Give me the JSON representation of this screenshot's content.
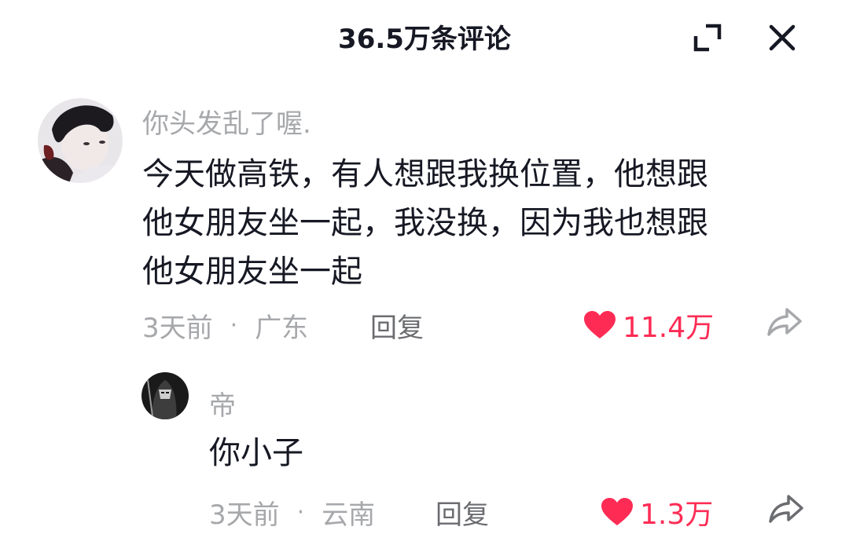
{
  "header": {
    "title": "36.5万条评论",
    "expand_icon": "expand-icon",
    "close_icon": "close-icon"
  },
  "comments": [
    {
      "username": "你头发乱了喔.",
      "text_lines": [
        "今天做高铁，有人想跟我换位置，他想跟",
        "他女朋友坐一起，我没换，因为我也想跟",
        "他女朋友坐一起"
      ],
      "time": "3天前",
      "separator": "·",
      "location": "广东",
      "reply_label": "回复",
      "likes": "11.4万",
      "liked": true
    }
  ],
  "reply": {
    "username": "帝",
    "text": "你小子",
    "time": "3天前",
    "separator": "·",
    "location": "云南",
    "reply_label": "回复",
    "likes": "1.3万",
    "liked": true
  },
  "colors": {
    "like_red": "#fe2c55",
    "meta_gray": "#a7a8ab",
    "text_dark": "#161823"
  }
}
